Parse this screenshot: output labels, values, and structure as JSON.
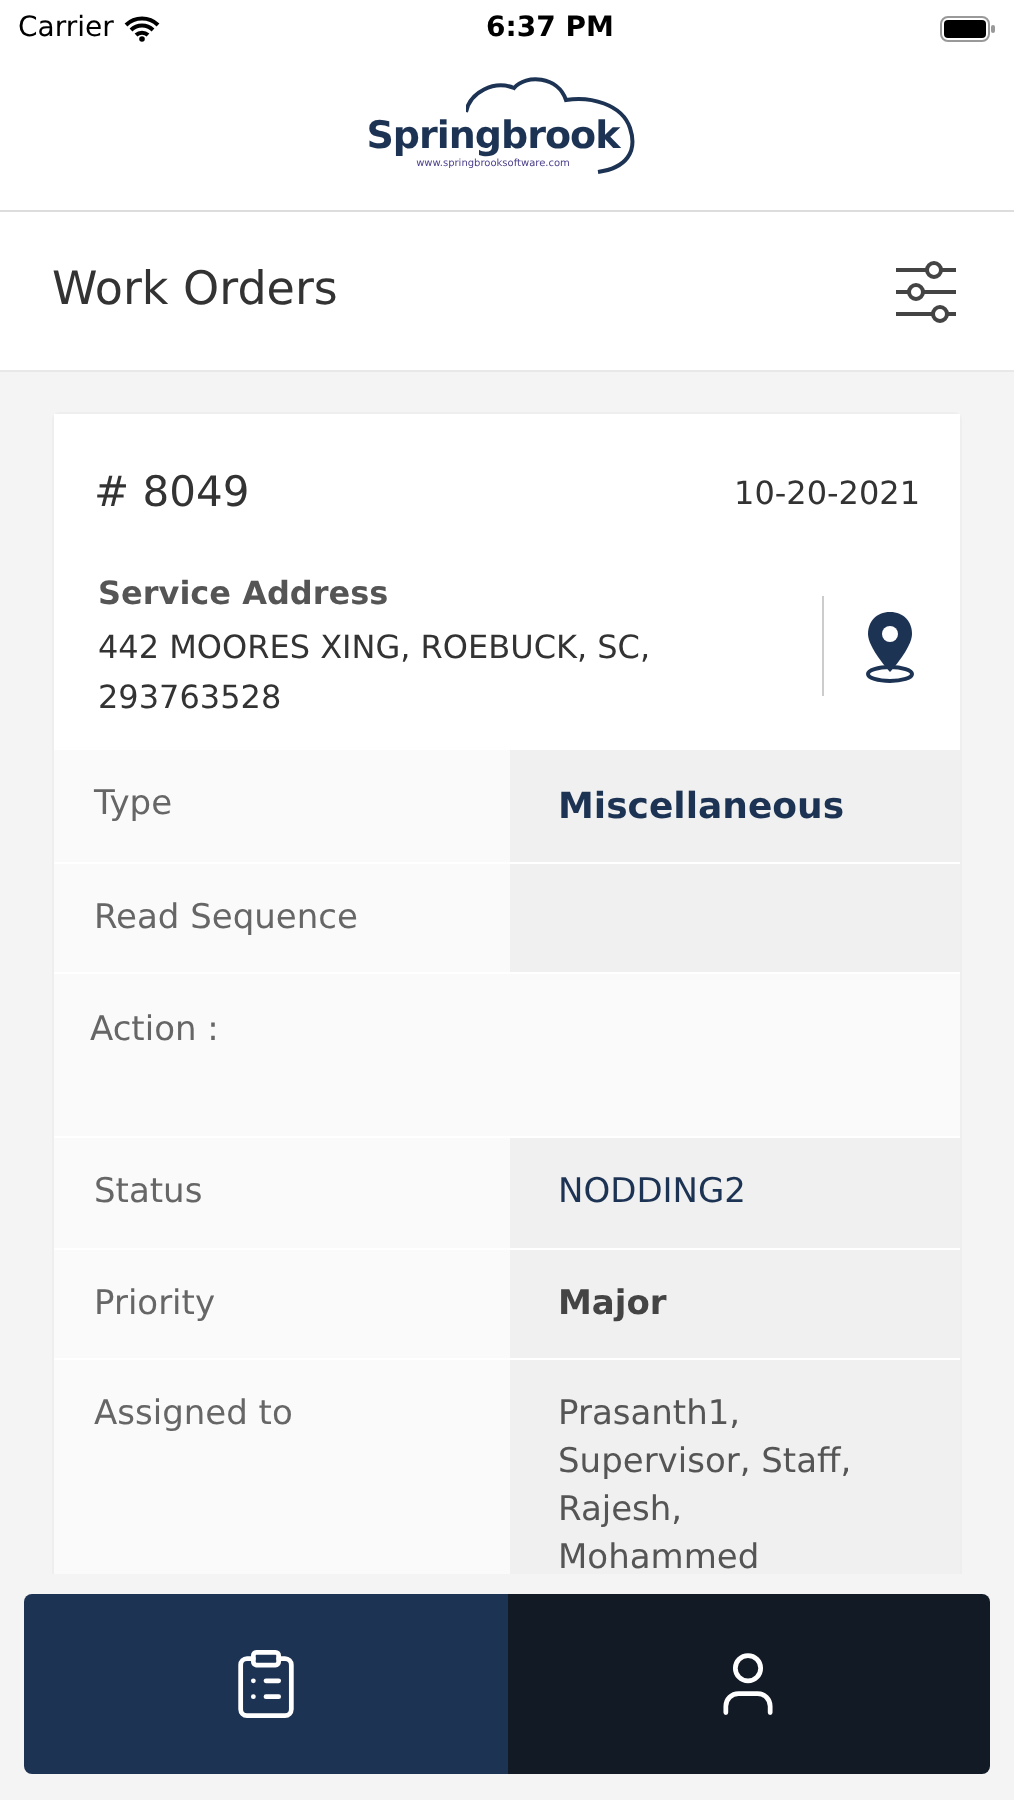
{
  "status_bar": {
    "carrier": "Carrier",
    "time": "6:37 PM"
  },
  "logo": {
    "name": "Springbrook",
    "url": "www.springbrooksoftware.com"
  },
  "page": {
    "title": "Work Orders"
  },
  "work_order": {
    "number": "# 8049",
    "date": "10-20-2021",
    "address_label": "Service Address",
    "address": "442 MOORES XING, ROEBUCK, SC, 293763528",
    "rows": [
      {
        "kind": "primary",
        "label": "Type",
        "value": "Miscellaneous"
      },
      {
        "kind": "text",
        "label": "Read Sequence"
      },
      {
        "kind": "heading",
        "label": "Action :"
      },
      {
        "kind": "status",
        "label": "Status",
        "value": "NODDING2"
      },
      {
        "kind": "bold",
        "label": "Priority",
        "value": "Major"
      },
      {
        "kind": "text",
        "label": "Assigned to",
        "value": "Prasanth1, Supervisor, Staff, Rajesh, Mohammed"
      }
    ]
  },
  "tab_bar": [
    {
      "kind": "orders",
      "selected": true
    },
    {
      "kind": "profile",
      "selected": false
    }
  ]
}
